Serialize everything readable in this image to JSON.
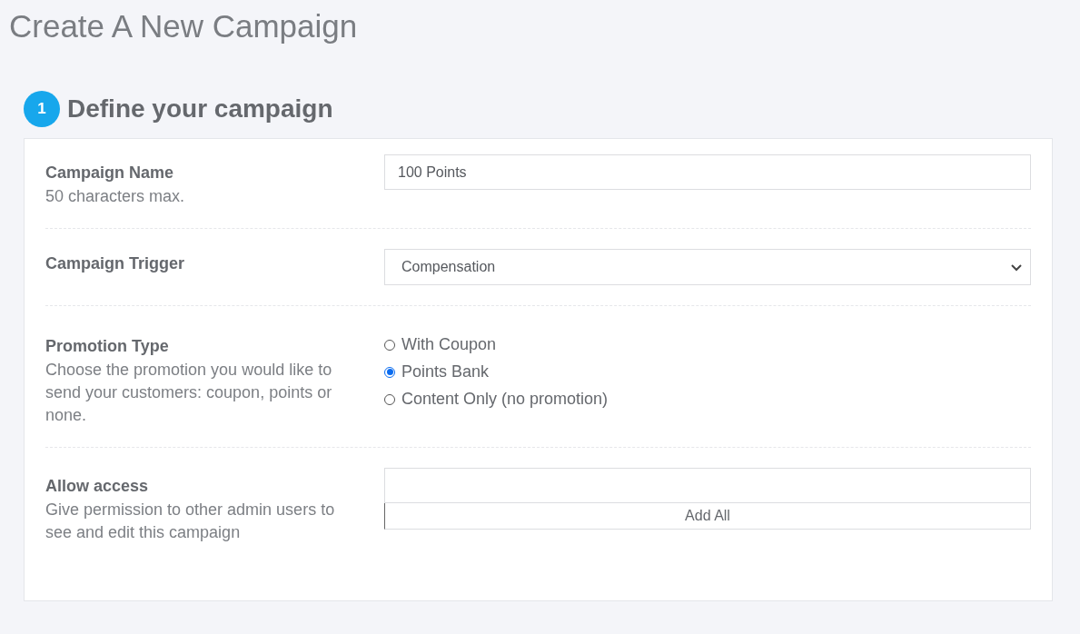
{
  "page_title": "Create A New Campaign",
  "section": {
    "step": "1",
    "title": "Define your campaign"
  },
  "rows": [
    {
      "kind": "text",
      "label": "Campaign Name",
      "description": "50 characters max.",
      "value": "100 Points"
    },
    {
      "kind": "select",
      "label": "Campaign Trigger",
      "value": "Compensation"
    },
    {
      "kind": "radio",
      "label": "Promotion Type",
      "description": "Choose the promotion you would like to send your customers: coupon, points or none.",
      "options": [
        {
          "label": "With Coupon",
          "selected": false
        },
        {
          "label": "Points Bank",
          "selected": true
        },
        {
          "label": "Content Only (no promotion)",
          "selected": false
        }
      ]
    },
    {
      "kind": "access",
      "label": "Allow access",
      "description": "Give permission to other admin users to see and edit this campaign",
      "button": "Add All"
    }
  ]
}
